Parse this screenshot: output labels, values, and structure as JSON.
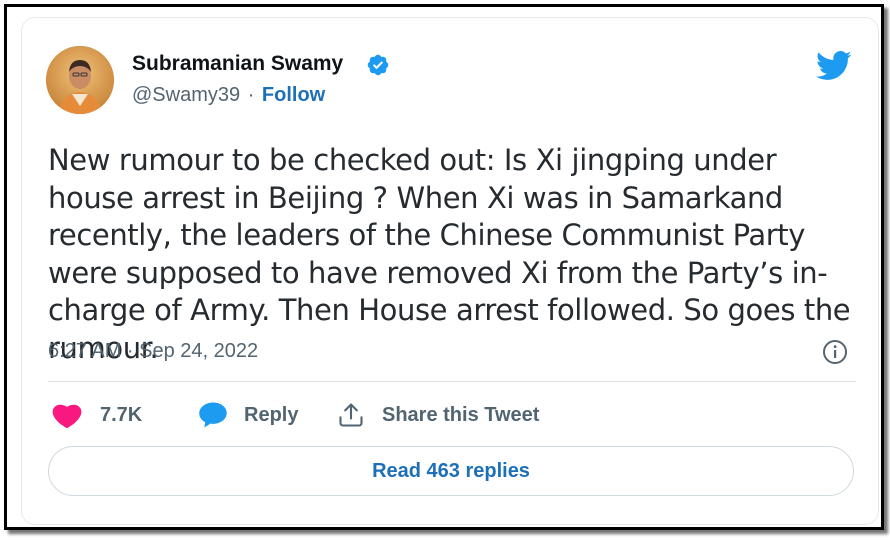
{
  "tweet": {
    "author": {
      "name": "Subramanian Swamy",
      "handle": "@Swamy39",
      "separator": "·",
      "follow_label": "Follow",
      "verified": true
    },
    "text": "New rumour to be checked out: Is Xi jingping under house arrest in Beijing ? When Xi was in Samarkand recently, the leaders of the Chinese Communist Party were supposed to have removed Xi from the Party’s in-charge of Army. Then House arrest followed. So goes the rumour.",
    "timestamp": "6:27 AM · Sep 24, 2022",
    "actions": {
      "like_count": "7.7K",
      "reply_label": "Reply",
      "share_label": "Share this Tweet"
    },
    "read_replies_label": "Read 463 replies"
  },
  "icons": {
    "brand": "twitter-bird-icon",
    "verified": "verified-badge-icon",
    "info": "info-icon",
    "like": "heart-icon",
    "reply": "speech-bubble-icon",
    "share": "share-upload-icon"
  },
  "colors": {
    "brand_blue": "#1d9bf0",
    "link_blue": "#1d70b8",
    "like_pink": "#f91880",
    "muted_text": "#536471",
    "text": "#0f1419"
  }
}
